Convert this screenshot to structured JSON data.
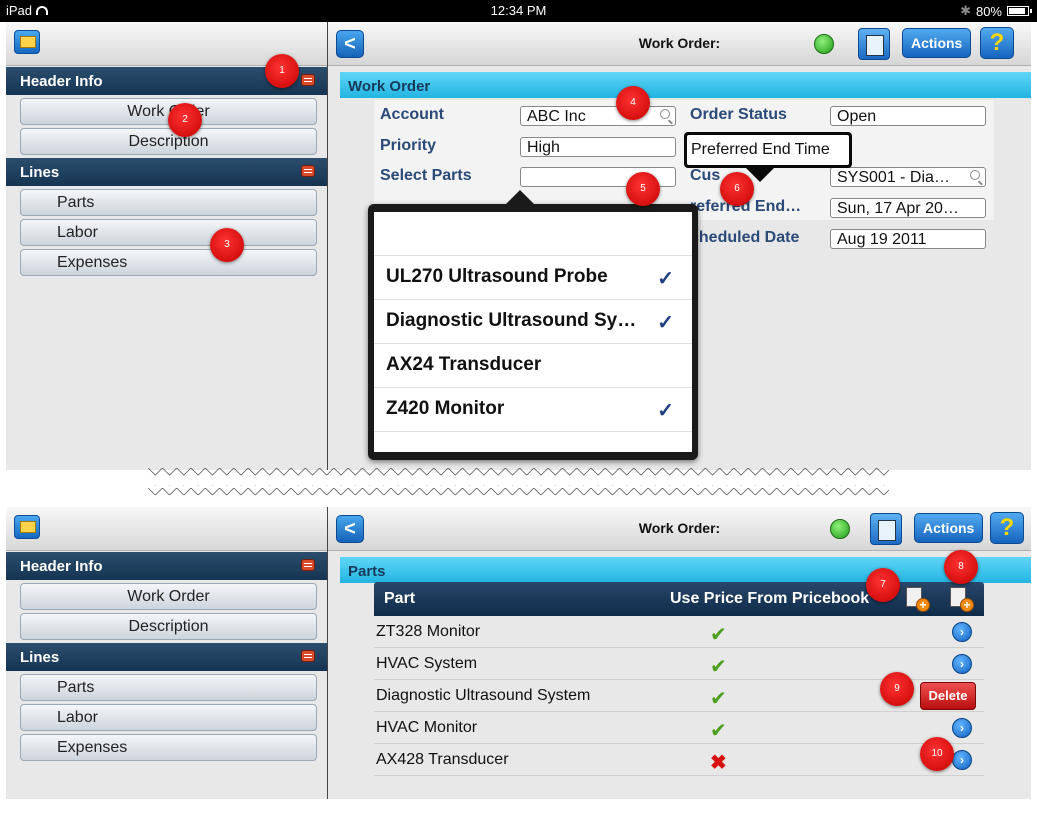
{
  "status_bar": {
    "device": "iPad",
    "time": "12:34 PM",
    "battery": "80%"
  },
  "sidebar": {
    "sections": [
      {
        "title": "Header Info",
        "items": [
          "Work Order",
          "Description"
        ]
      },
      {
        "title": "Lines",
        "items": [
          "Parts",
          "Labor",
          "Expenses"
        ]
      }
    ]
  },
  "toolbar": {
    "title": "Work Order:",
    "actions_label": "Actions",
    "help_label": "?",
    "back_label": "<"
  },
  "top_screen": {
    "section_title": "Work Order",
    "fields": {
      "account": {
        "label": "Account",
        "value": "ABC Inc"
      },
      "priority": {
        "label": "Priority",
        "value": "High"
      },
      "select_parts": {
        "label": "Select  Parts",
        "value": ""
      },
      "order_status": {
        "label": "Order Status",
        "value": "Open"
      },
      "customer": {
        "label": "Cus",
        "value": "SYS001 - Dia…"
      },
      "preferred_end": {
        "label": "referred End…",
        "value": "Sun, 17 Apr 20…"
      },
      "scheduled_date": {
        "label": "cheduled Date",
        "value": "Aug 19 2011"
      }
    },
    "tooltip": "Preferred End Time",
    "popover_items": [
      {
        "label": "UL270 Ultrasound Probe",
        "checked": true
      },
      {
        "label": "Diagnostic Ultrasound Sy…",
        "checked": true
      },
      {
        "label": "AX24 Transducer",
        "checked": false
      },
      {
        "label": "Z420 Monitor",
        "checked": true
      }
    ]
  },
  "bottom_screen": {
    "section_title": "Parts",
    "columns": [
      "Part",
      "Use Price From Pricebook"
    ],
    "rows": [
      {
        "part": "ZT328 Monitor",
        "use_price": true
      },
      {
        "part": "HVAC System",
        "use_price": true
      },
      {
        "part": "Diagnostic Ultrasound System",
        "use_price": true,
        "delete_label": "Delete"
      },
      {
        "part": "HVAC Monitor",
        "use_price": true
      },
      {
        "part": "AX428 Transducer",
        "use_price": false
      }
    ]
  },
  "callouts": [
    "1",
    "2",
    "3",
    "4",
    "5",
    "6",
    "7",
    "8",
    "9",
    "10"
  ],
  "colors": {
    "accent_blue": "#1564bf",
    "header_navy": "#143452",
    "section_cyan": "#22b4e2",
    "badge_red": "#c40000"
  }
}
